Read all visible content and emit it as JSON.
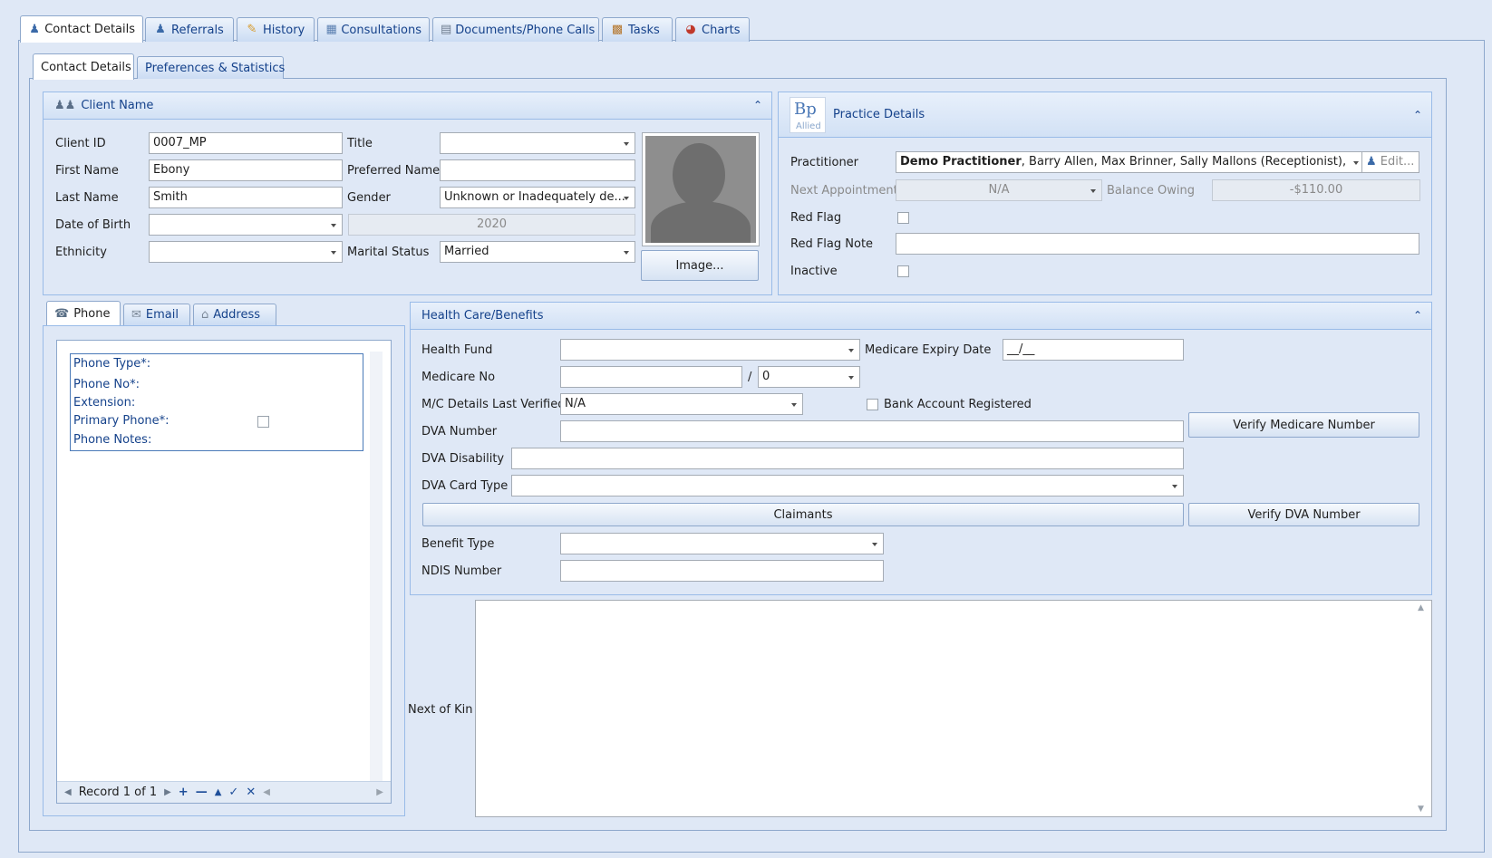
{
  "main_tabs": [
    {
      "label": "Contact Details",
      "icon": "person-icon"
    },
    {
      "label": "Referrals",
      "icon": "referral-icon"
    },
    {
      "label": "History",
      "icon": "pencil-icon"
    },
    {
      "label": "Consultations",
      "icon": "calendar-icon"
    },
    {
      "label": "Documents/Phone Calls",
      "icon": "document-icon"
    },
    {
      "label": "Tasks",
      "icon": "clipboard-icon"
    },
    {
      "label": "Charts",
      "icon": "chart-icon"
    }
  ],
  "sub_tabs": [
    {
      "label": "Contact Details"
    },
    {
      "label": "Preferences & Statistics"
    }
  ],
  "client_name": {
    "header": "Client Name",
    "client_id_label": "Client ID",
    "client_id": "0007_MP",
    "title_label": "Title",
    "title": "",
    "first_name_label": "First Name",
    "first_name": "Ebony",
    "preferred_name_label": "Preferred Name",
    "preferred_name": "",
    "last_name_label": "Last Name",
    "last_name": "Smith",
    "gender_label": "Gender",
    "gender": "Unknown or Inadequately de...",
    "dob_label": "Date of Birth",
    "dob": "",
    "year": "2020",
    "ethnicity_label": "Ethnicity",
    "ethnicity": "",
    "marital_status_label": "Marital Status",
    "marital_status": "Married",
    "image_button": "Image..."
  },
  "practice": {
    "header": "Practice Details",
    "logo_text": "Bp",
    "logo_sub": "Allied",
    "practitioner_label": "Practitioner",
    "practitioner_bold": "Demo Practitioner",
    "practitioner_rest": ", Barry Allen, Max Brinner, Sally  Mallons (Receptionist),",
    "edit_label": "Edit...",
    "next_appt_label": "Next Appointment",
    "next_appt": "N/A",
    "balance_label": "Balance Owing",
    "balance": "-$110.00",
    "red_flag_label": "Red Flag",
    "red_flag_checked": false,
    "red_flag_note_label": "Red Flag Note",
    "red_flag_note": "",
    "inactive_label": "Inactive",
    "inactive_checked": false
  },
  "contact_tabs": [
    {
      "label": "Phone",
      "icon": "phone-icon"
    },
    {
      "label": "Email",
      "icon": "email-icon"
    },
    {
      "label": "Address",
      "icon": "house-icon"
    }
  ],
  "phone": {
    "type_label": "Phone Type*:",
    "no_label": "Phone No*:",
    "ext_label": "Extension:",
    "primary_label": "Primary Phone*:",
    "notes_label": "Phone Notes:",
    "record_text": "Record 1 of 1"
  },
  "health": {
    "header": "Health Care/Benefits",
    "health_fund_label": "Health Fund",
    "health_fund": "",
    "medicare_expiry_label": "Medicare Expiry Date",
    "medicare_expiry": "__/__",
    "medicare_no_label": "Medicare No",
    "medicare_no": "",
    "medicare_sep": "/",
    "medicare_irn": "0",
    "mc_verified_label": "M/C Details Last Verified",
    "mc_verified": "N/A",
    "bank_label": "Bank Account Registered",
    "verify_medicare": "Verify Medicare Number",
    "dva_number_label": "DVA Number",
    "dva_disability_label": "DVA Disability",
    "dva_card_label": "DVA Card Type",
    "claimants": "Claimants",
    "verify_dva": "Verify DVA Number",
    "benefit_type_label": "Benefit Type",
    "ndis_label": "NDIS Number"
  },
  "next_of_kin_label": "Next of Kin",
  "colors": {
    "background": "#dfe8f6",
    "header_text": "#15428b",
    "border": "#99bbe8"
  }
}
